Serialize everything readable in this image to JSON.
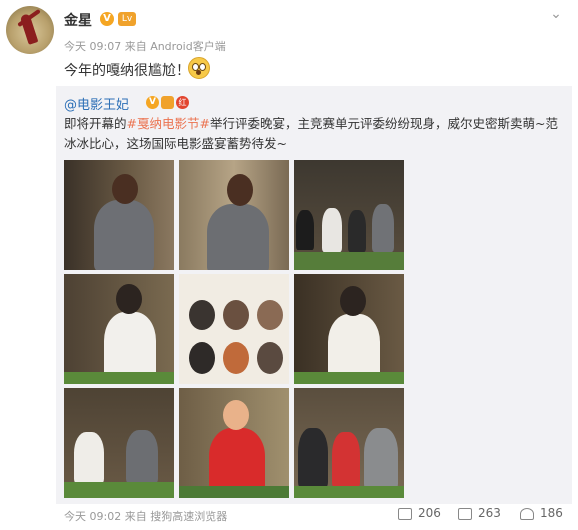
{
  "post": {
    "author": "金星",
    "verified_badge": "V",
    "level_badge": "Lv",
    "meta": "今天 09:07 来自 Android客户端",
    "text": "今年的嘎纳很尴尬！"
  },
  "repost": {
    "author": "@电影王妃",
    "text_before": "即将开幕的",
    "hashtag": "#戛纳电影节#",
    "text_after": "举行评委晚宴，主竞赛单元评委纷纷现身，威尔史密斯卖萌~范冰冰比心，这场国际电影盛宴蓄势待发~",
    "time": "今天 09:02 来自 搜狗高速浏览器",
    "images": [
      {
        "name": "photo-1"
      },
      {
        "name": "photo-2"
      },
      {
        "name": "photo-3"
      },
      {
        "name": "photo-4"
      },
      {
        "name": "photo-5"
      },
      {
        "name": "photo-6"
      },
      {
        "name": "photo-7"
      },
      {
        "name": "photo-8"
      },
      {
        "name": "photo-9"
      }
    ],
    "actions": {
      "forward_count": "206",
      "comment_count": "263",
      "like_count": "186"
    }
  },
  "colors": {
    "link": "#2c6fb6",
    "hashtag": "#eb7350",
    "repost_bg": "#f2f2f5",
    "badge": "#f5a623"
  }
}
